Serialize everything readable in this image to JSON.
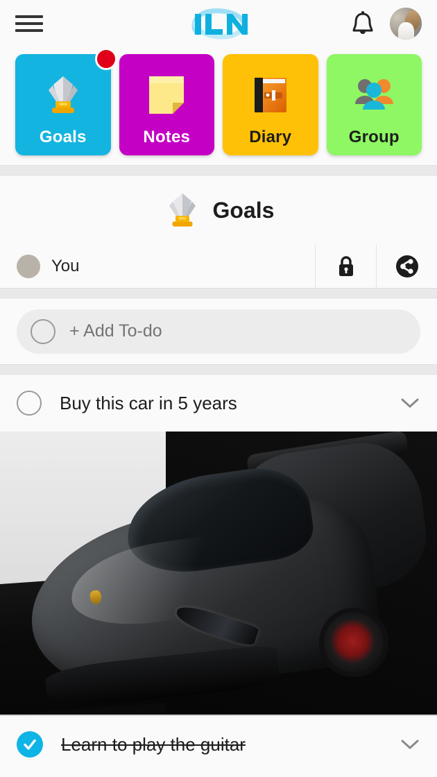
{
  "topbar": {
    "menu_icon": "hamburger-menu-icon",
    "logo_text": "ILN",
    "notification_icon": "bell-icon",
    "avatar_icon": "user-avatar"
  },
  "categories": [
    {
      "label": "Goals",
      "color": "#14b4e0",
      "icon": "trophy-icon",
      "badge": true
    },
    {
      "label": "Notes",
      "color": "#c400c4",
      "icon": "sticky-note-icon",
      "badge": false
    },
    {
      "label": "Diary",
      "color": "#ffc107",
      "icon": "closed-book-icon",
      "badge": false
    },
    {
      "label": "Group",
      "color": "#8ef763",
      "icon": "people-group-icon",
      "badge": false
    }
  ],
  "section": {
    "title": "Goals",
    "icon": "trophy-icon"
  },
  "user_row": {
    "name": "You",
    "lock_icon": "lock-icon",
    "share_icon": "share-icon"
  },
  "add_todo": {
    "placeholder": "+ Add To-do",
    "checkbox_icon": "empty-circle-icon"
  },
  "todos": [
    {
      "text": "Buy this car in 5 years",
      "done": false,
      "checkbox_icon": "empty-circle-icon",
      "expand_icon": "chevron-down-icon",
      "attachment": "car-photo"
    },
    {
      "text": "Learn to play the guitar",
      "done": true,
      "checkbox_icon": "checked-circle-icon",
      "expand_icon": "chevron-down-icon"
    }
  ],
  "colors": {
    "accent": "#0fb4e6",
    "badge": "#e00019",
    "page_bg": "#fafafa",
    "separator": "#e9e9e9"
  }
}
